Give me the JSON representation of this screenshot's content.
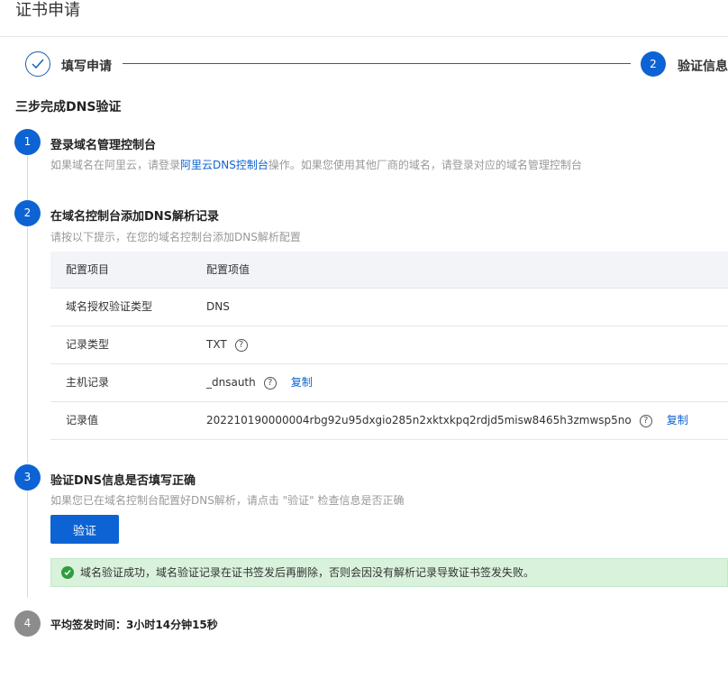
{
  "header": {
    "title": "证书申请"
  },
  "stepper": {
    "step1": {
      "label": "填写申请",
      "status": "done"
    },
    "step2": {
      "number": "2",
      "label": "验证信息",
      "status": "active"
    }
  },
  "section_title": "三步完成DNS验证",
  "steps": [
    {
      "number": "1",
      "title": "登录域名管理控制台",
      "desc_before": "如果域名在阿里云，请登录",
      "desc_link": "阿里云DNS控制台",
      "desc_after": "操作。如果您使用其他厂商的域名，请登录对应的域名管理控制台"
    },
    {
      "number": "2",
      "title": "在域名控制台添加DNS解析记录",
      "desc": "请按以下提示，在您的域名控制台添加DNS解析配置"
    },
    {
      "number": "3",
      "title": "验证DNS信息是否填写正确",
      "desc": "如果您已在域名控制台配置好DNS解析，请点击 \"验证\" 检查信息是否正确"
    },
    {
      "number": "4",
      "avg_label": "平均签发时间：",
      "avg_value": "3小时14分钟15秒"
    }
  ],
  "table": {
    "headers": [
      "配置项目",
      "配置项值"
    ],
    "rows": [
      {
        "item": "域名授权验证类型",
        "value": "DNS"
      },
      {
        "item": "记录类型",
        "value": "TXT"
      },
      {
        "item": "主机记录",
        "value": "_dnsauth",
        "copy": "复制"
      },
      {
        "item": "记录值",
        "value": "202210190000004rbg92u95dxgio285n2xktxkpq2rdjd5misw8465h3zmwsp5no",
        "copy": "复制"
      }
    ]
  },
  "verify_button": "验证",
  "success_message": "域名验证成功，域名验证记录在证书签发后再删除，否则会因没有解析记录导致证书签发失败。",
  "colors": {
    "primary": "#0d63d3",
    "success_bg": "#d9f2dc",
    "success_icon": "#2e9e3e",
    "table_header_bg": "#f2f4f7",
    "step_pending": "#8c8c8c"
  }
}
